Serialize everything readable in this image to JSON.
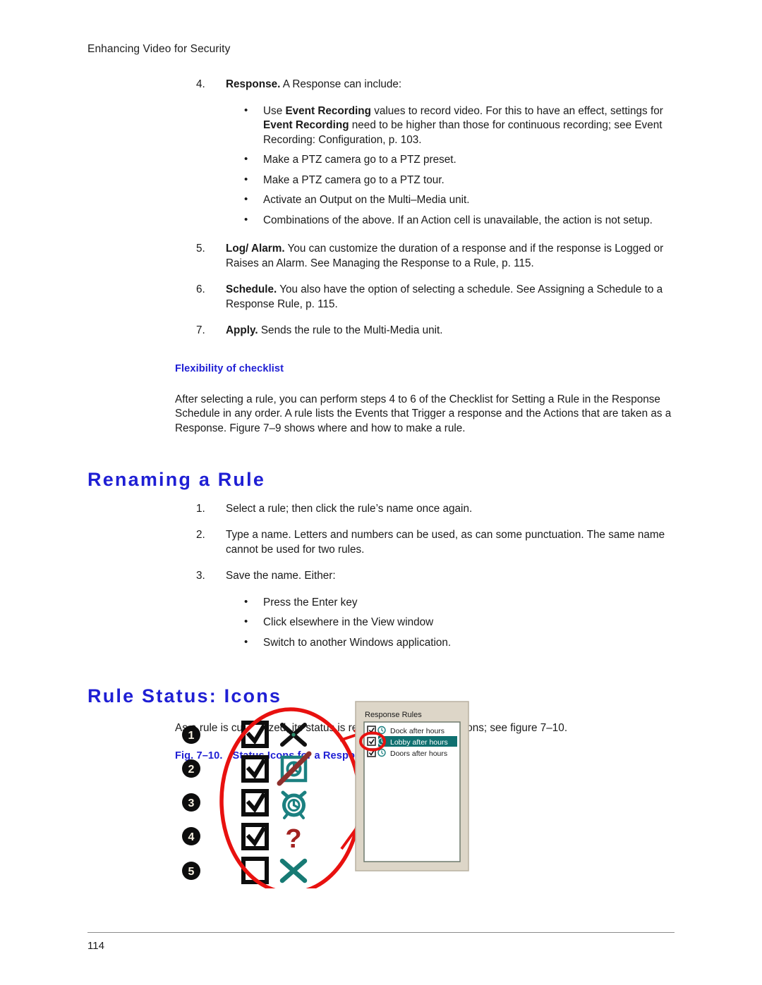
{
  "document": {
    "running_header": "Enhancing Video for Security",
    "page_number": "114"
  },
  "checklist_steps": [
    {
      "num": "4.",
      "bold": "Response.",
      "text": " A Response can include:"
    },
    {
      "num": "5.",
      "bold": "Log/ Alarm.",
      "text": " You can customize the duration of a response and if the response is Logged or Raises an Alarm. See Managing the Response to a Rule, p. 115."
    },
    {
      "num": "6.",
      "bold": "Schedule.",
      "text": " You also have the option of selecting a schedule. See Assigning a Schedule to a Response Rule, p. 115."
    },
    {
      "num": "7.",
      "bold": "Apply.",
      "text": " Sends the rule to the Multi-Media unit."
    }
  ],
  "response_bullets": [
    {
      "pre": "Use ",
      "bold1": "Event Recording",
      "mid": " values to record video. For this to have an effect, settings for ",
      "bold2": "Event Recording",
      "post": " need to be higher than those for continuous recording; see Event Recording: Configuration, p. 103."
    },
    {
      "pre": "Make a PTZ camera go to a PTZ preset."
    },
    {
      "pre": "Make a PTZ camera go to a PTZ tour."
    },
    {
      "pre": "Activate an Output on the Multi–Media unit."
    },
    {
      "pre": "Combinations of the above. If an Action cell is unavailable, the action is not setup."
    }
  ],
  "flexibility": {
    "subhead": "Flexibility of checklist",
    "paragraph": "After selecting a rule, you can perform steps 4 to 6 of the Checklist for Setting a Rule in the Response Schedule in any order. A rule lists the Events that Trigger a response and the Actions that are taken as a Response. Figure 7–9 shows where and how to make a rule."
  },
  "renaming_section": {
    "heading": "Renaming a Rule",
    "steps": [
      {
        "num": "1.",
        "text": "Select a rule; then click the rule’s name once again."
      },
      {
        "num": "2.",
        "text": "Type a name. Letters and numbers can be used, as can some punctuation. The same name cannot be used for two rules."
      },
      {
        "num": "3.",
        "text": "Save the name. Either:"
      }
    ],
    "bullets": [
      "Press the Enter key",
      "Click elsewhere in the View window",
      "Switch to another Windows application."
    ]
  },
  "rule_status_section": {
    "heading": "Rule Status: Icons",
    "paragraph": "As a rule is customized, its status is reported by one of five icons; see figure 7–10.",
    "figure_caption": {
      "number": "Fig. 7–10.",
      "title": "Status Icons for a Response Rule."
    }
  },
  "figure": {
    "callout_numbers": [
      "1",
      "2",
      "3",
      "4",
      "5"
    ],
    "status_rows": [
      {
        "checkbox": "checked",
        "icon": "black-x-icon"
      },
      {
        "checkbox": "checked",
        "icon": "clock-disabled-icon"
      },
      {
        "checkbox": "checked",
        "icon": "alarm-clock-icon"
      },
      {
        "checkbox": "checked",
        "icon": "red-question-mark-icon"
      },
      {
        "checkbox": "unchecked",
        "icon": "teal-x-icon"
      }
    ],
    "response_rules_panel": {
      "title": "Response Rules",
      "rules": [
        {
          "label": "Dock after hours",
          "checked": true,
          "selected": false
        },
        {
          "label": "Lobby after hours",
          "checked": true,
          "selected": true
        },
        {
          "label": "Doors after hours",
          "checked": true,
          "selected": false
        }
      ]
    },
    "colors": {
      "annotation_red": "#e8110f",
      "teal": "#167c7c",
      "dark_red": "#9b2d2a",
      "selection_teal": "#0f7070",
      "panel_beige": "#ddd6c8"
    }
  }
}
